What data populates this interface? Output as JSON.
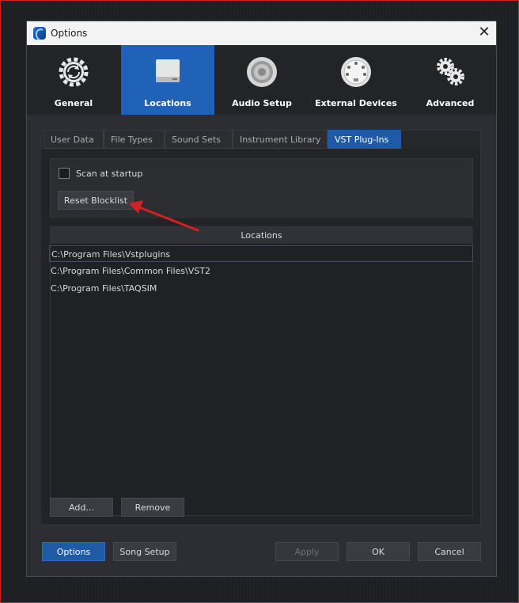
{
  "window": {
    "title": "Options",
    "close_symbol": "✕"
  },
  "toolbar": {
    "items": [
      {
        "label": "General",
        "icon": "gear-refresh-icon"
      },
      {
        "label": "Locations",
        "icon": "drive-icon",
        "active": true
      },
      {
        "label": "Audio Setup",
        "icon": "speaker-icon"
      },
      {
        "label": "External Devices",
        "icon": "midi-connector-icon"
      },
      {
        "label": "Advanced",
        "icon": "gears-icon"
      }
    ]
  },
  "tabs": [
    {
      "label": "User Data"
    },
    {
      "label": "File Types"
    },
    {
      "label": "Sound Sets"
    },
    {
      "label": "Instrument Library"
    },
    {
      "label": "VST Plug-Ins",
      "active": true
    }
  ],
  "options": {
    "scan_at_startup_label": "Scan at startup",
    "scan_at_startup_checked": false,
    "reset_blocklist_label": "Reset Blocklist"
  },
  "locations": {
    "header": "Locations",
    "rows": [
      "C:\\Program Files\\Vstplugins",
      "C:\\Program Files\\Common Files\\VST2",
      "C:\\Program Files\\TAQSIM"
    ],
    "add_label": "Add...",
    "remove_label": "Remove"
  },
  "footer": {
    "options_label": "Options",
    "song_setup_label": "Song Setup",
    "apply_label": "Apply",
    "ok_label": "OK",
    "cancel_label": "Cancel"
  },
  "colors": {
    "accent": "#1f62b8",
    "annotation_arrow": "#d42020"
  }
}
